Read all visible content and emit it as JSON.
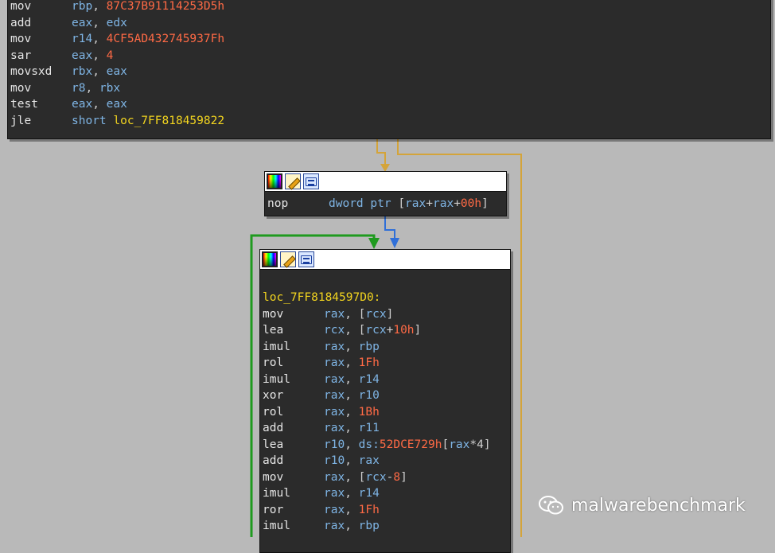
{
  "block1": {
    "lines": [
      {
        "mn": "mov",
        "ops": [
          {
            "t": "rbp",
            "k": "rg"
          },
          {
            "t": ", ",
            "k": "pc"
          },
          {
            "t": "87C37B91114253D5h",
            "k": "im"
          }
        ]
      },
      {
        "mn": "add",
        "ops": [
          {
            "t": "eax",
            "k": "rg"
          },
          {
            "t": ", ",
            "k": "pc"
          },
          {
            "t": "edx",
            "k": "rg"
          }
        ]
      },
      {
        "mn": "mov",
        "ops": [
          {
            "t": "r14",
            "k": "rg"
          },
          {
            "t": ", ",
            "k": "pc"
          },
          {
            "t": "4CF5AD432745937Fh",
            "k": "im"
          }
        ]
      },
      {
        "mn": "sar",
        "ops": [
          {
            "t": "eax",
            "k": "rg"
          },
          {
            "t": ", ",
            "k": "pc"
          },
          {
            "t": "4",
            "k": "im"
          }
        ]
      },
      {
        "mn": "movsxd",
        "ops": [
          {
            "t": "rbx",
            "k": "rg"
          },
          {
            "t": ", ",
            "k": "pc"
          },
          {
            "t": "eax",
            "k": "rg"
          }
        ]
      },
      {
        "mn": "mov",
        "ops": [
          {
            "t": "r8",
            "k": "rg"
          },
          {
            "t": ", ",
            "k": "pc"
          },
          {
            "t": "rbx",
            "k": "rg"
          }
        ]
      },
      {
        "mn": "test",
        "ops": [
          {
            "t": "eax",
            "k": "rg"
          },
          {
            "t": ", ",
            "k": "pc"
          },
          {
            "t": "eax",
            "k": "rg"
          }
        ]
      },
      {
        "mn": "jle",
        "ops": [
          {
            "t": "short ",
            "k": "rg"
          },
          {
            "t": "loc_7FF818459822",
            "k": "lb"
          }
        ]
      }
    ]
  },
  "block2": {
    "lines": [
      {
        "mn": "nop",
        "ops": [
          {
            "t": "dword ptr ",
            "k": "rg"
          },
          {
            "t": "[",
            "k": "pc"
          },
          {
            "t": "rax",
            "k": "rg"
          },
          {
            "t": "+",
            "k": "pc"
          },
          {
            "t": "rax",
            "k": "rg"
          },
          {
            "t": "+",
            "k": "pc"
          },
          {
            "t": "00h",
            "k": "im"
          },
          {
            "t": "]",
            "k": "pc"
          }
        ]
      }
    ]
  },
  "block3": {
    "label": "loc_7FF8184597D0:",
    "lines": [
      {
        "mn": "mov",
        "ops": [
          {
            "t": "rax",
            "k": "rg"
          },
          {
            "t": ", ",
            "k": "pc"
          },
          {
            "t": "[",
            "k": "pc"
          },
          {
            "t": "rcx",
            "k": "rg"
          },
          {
            "t": "]",
            "k": "pc"
          }
        ]
      },
      {
        "mn": "lea",
        "ops": [
          {
            "t": "rcx",
            "k": "rg"
          },
          {
            "t": ", ",
            "k": "pc"
          },
          {
            "t": "[",
            "k": "pc"
          },
          {
            "t": "rcx",
            "k": "rg"
          },
          {
            "t": "+",
            "k": "pc"
          },
          {
            "t": "10h",
            "k": "im"
          },
          {
            "t": "]",
            "k": "pc"
          }
        ]
      },
      {
        "mn": "imul",
        "ops": [
          {
            "t": "rax",
            "k": "rg"
          },
          {
            "t": ", ",
            "k": "pc"
          },
          {
            "t": "rbp",
            "k": "rg"
          }
        ]
      },
      {
        "mn": "rol",
        "ops": [
          {
            "t": "rax",
            "k": "rg"
          },
          {
            "t": ", ",
            "k": "pc"
          },
          {
            "t": "1Fh",
            "k": "im"
          }
        ]
      },
      {
        "mn": "imul",
        "ops": [
          {
            "t": "rax",
            "k": "rg"
          },
          {
            "t": ", ",
            "k": "pc"
          },
          {
            "t": "r14",
            "k": "rg"
          }
        ]
      },
      {
        "mn": "xor",
        "ops": [
          {
            "t": "rax",
            "k": "rg"
          },
          {
            "t": ", ",
            "k": "pc"
          },
          {
            "t": "r10",
            "k": "rg"
          }
        ]
      },
      {
        "mn": "rol",
        "ops": [
          {
            "t": "rax",
            "k": "rg"
          },
          {
            "t": ", ",
            "k": "pc"
          },
          {
            "t": "1Bh",
            "k": "im"
          }
        ]
      },
      {
        "mn": "add",
        "ops": [
          {
            "t": "rax",
            "k": "rg"
          },
          {
            "t": ", ",
            "k": "pc"
          },
          {
            "t": "r11",
            "k": "rg"
          }
        ]
      },
      {
        "mn": "lea",
        "ops": [
          {
            "t": "r10",
            "k": "rg"
          },
          {
            "t": ", ",
            "k": "pc"
          },
          {
            "t": "ds:",
            "k": "rg"
          },
          {
            "t": "52DCE729h",
            "k": "im"
          },
          {
            "t": "[",
            "k": "pc"
          },
          {
            "t": "rax",
            "k": "rg"
          },
          {
            "t": "*4]",
            "k": "pc"
          }
        ]
      },
      {
        "mn": "add",
        "ops": [
          {
            "t": "r10",
            "k": "rg"
          },
          {
            "t": ", ",
            "k": "pc"
          },
          {
            "t": "rax",
            "k": "rg"
          }
        ]
      },
      {
        "mn": "mov",
        "ops": [
          {
            "t": "rax",
            "k": "rg"
          },
          {
            "t": ", ",
            "k": "pc"
          },
          {
            "t": "[",
            "k": "pc"
          },
          {
            "t": "rcx",
            "k": "rg"
          },
          {
            "t": "-",
            "k": "pc"
          },
          {
            "t": "8",
            "k": "im"
          },
          {
            "t": "]",
            "k": "pc"
          }
        ]
      },
      {
        "mn": "imul",
        "ops": [
          {
            "t": "rax",
            "k": "rg"
          },
          {
            "t": ", ",
            "k": "pc"
          },
          {
            "t": "r14",
            "k": "rg"
          }
        ]
      },
      {
        "mn": "ror",
        "ops": [
          {
            "t": "rax",
            "k": "rg"
          },
          {
            "t": ", ",
            "k": "pc"
          },
          {
            "t": "1Fh",
            "k": "im"
          }
        ]
      },
      {
        "mn": "imul",
        "ops": [
          {
            "t": "rax",
            "k": "rg"
          },
          {
            "t": ", ",
            "k": "pc"
          },
          {
            "t": "rbp",
            "k": "rg"
          }
        ]
      }
    ]
  },
  "header_icons": [
    "color-picker-icon",
    "rename-icon",
    "graph-overview-icon"
  ],
  "colors": {
    "background": "#b9b9b9",
    "node_bg": "#2b2b2b",
    "register": "#7fb5e5",
    "immediate": "#ff6a45",
    "label": "#f3d51f",
    "mnemonic": "#e6e6e6",
    "edge_false": "#d4a43a",
    "edge_true": "#1f9a1f",
    "edge_normal": "#2f6fd8"
  },
  "watermark": {
    "text": "malwarebenchmark",
    "icon": "wechat-icon"
  }
}
